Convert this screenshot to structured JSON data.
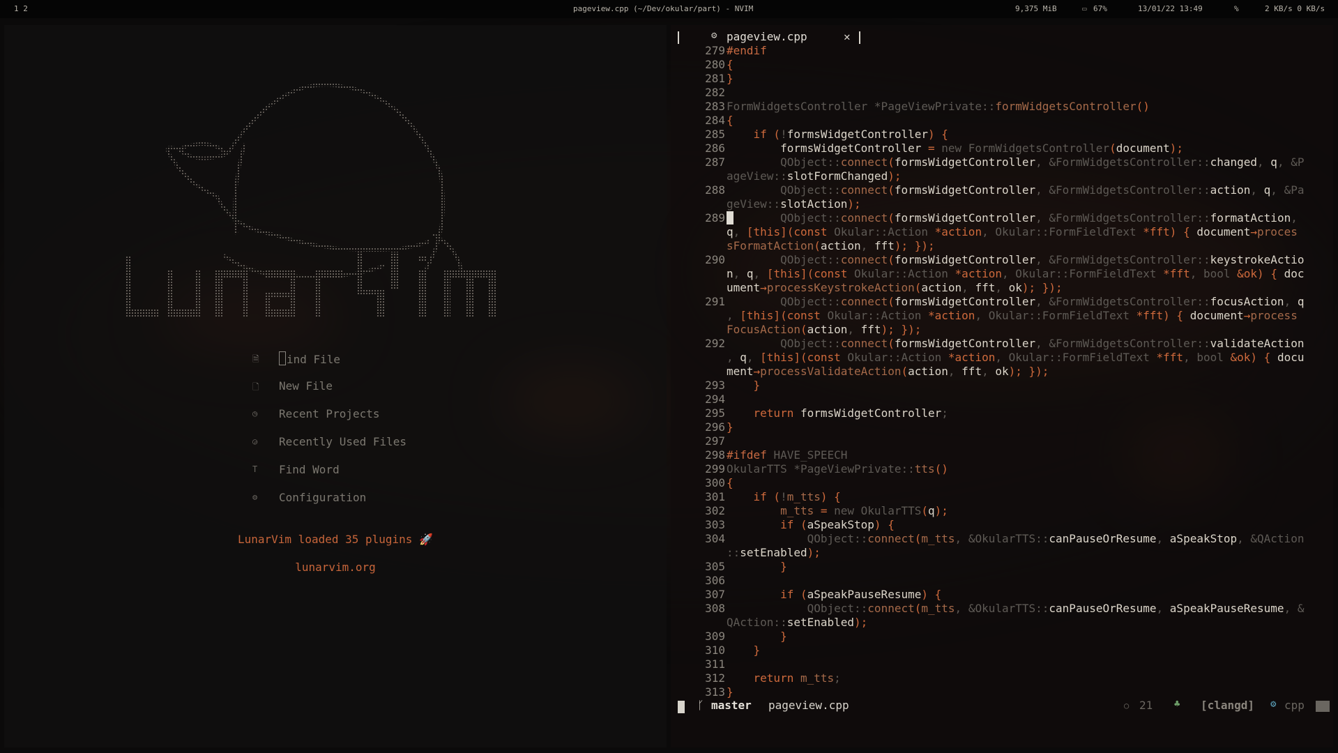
{
  "topbar": {
    "workspaces": "1 2",
    "title": "pageview.cpp (~/Dev/okular/part) - NVIM",
    "memory": "9,375 MiB",
    "battery": "67%",
    "datetime": "13/01/22 13:49",
    "net_icon": "%",
    "net_speed": "2 KB/s 0 KB/s"
  },
  "dashboard": {
    "logo_alt": "LunarVim",
    "items": [
      {
        "icon": "file-search-icon",
        "glyph": "🗎",
        "label": "Find File",
        "first_char": "F",
        "rest": "ind File"
      },
      {
        "icon": "new-file-icon",
        "glyph": "🗋",
        "label": "New File"
      },
      {
        "icon": "recent-projects-icon",
        "glyph": "◷",
        "label": "Recent Projects"
      },
      {
        "icon": "recent-files-icon",
        "glyph": "◶",
        "label": "Recently Used Files"
      },
      {
        "icon": "find-word-icon",
        "glyph": "T",
        "label": "Find Word"
      },
      {
        "icon": "config-gear-icon",
        "glyph": "⚙",
        "label": "Configuration"
      }
    ],
    "footer_loaded": "LunarVim loaded 35 plugins 🚀",
    "footer_site": "lunarvim.org"
  },
  "editor": {
    "tab": {
      "icon": "settings-file-icon",
      "name": "pageview.cpp",
      "close": "✕"
    },
    "statusline": {
      "branch_icon": "git-branch-icon",
      "branch": "master",
      "file": "pageview.cpp",
      "diag_icon": "warning-circle-icon",
      "diag_count": "21",
      "tree_icon": "tree-icon",
      "lsp": "[clangd]",
      "ft_icon": "cpp-icon",
      "filetype": "cpp"
    },
    "cursor_line": 289,
    "lines": [
      {
        "n": "279",
        "segs": [
          [
            "pp",
            "#endif"
          ]
        ]
      },
      {
        "n": "280",
        "segs": [
          [
            "k",
            "{"
          ]
        ]
      },
      {
        "n": "281",
        "segs": [
          [
            "k",
            "}"
          ]
        ]
      },
      {
        "n": "282",
        "segs": []
      },
      {
        "n": "283",
        "segs": [
          [
            "dim",
            "FormWidgetsController *PageViewPrivate"
          ],
          [
            "dim",
            "::"
          ],
          [
            "f",
            "formWidgetsController"
          ],
          [
            "k",
            "()"
          ]
        ]
      },
      {
        "n": "284",
        "segs": [
          [
            "k",
            "{"
          ]
        ]
      },
      {
        "n": "285",
        "segs": [
          [
            "",
            "    "
          ],
          [
            "k",
            "if ("
          ],
          [
            "dim",
            "!"
          ],
          [
            "id",
            "formsWidgetController"
          ],
          [
            "k",
            ") {"
          ]
        ]
      },
      {
        "n": "286",
        "segs": [
          [
            "",
            "        "
          ],
          [
            "id",
            "formsWidgetController "
          ],
          [
            "k",
            "= "
          ],
          [
            "dim",
            "new "
          ],
          [
            "dim",
            "FormWidgetsController"
          ],
          [
            "k",
            "("
          ],
          [
            "id",
            "document"
          ],
          [
            "k",
            ");"
          ]
        ]
      },
      {
        "n": "287",
        "segs": [
          [
            "",
            "        "
          ],
          [
            "dim",
            "QObject::"
          ],
          [
            "f",
            "connect"
          ],
          [
            "k",
            "("
          ],
          [
            "id",
            "formsWidgetController"
          ],
          [
            "dim",
            ", &FormWidgetsController::"
          ],
          [
            "id",
            "changed"
          ],
          [
            "dim",
            ", "
          ],
          [
            "id",
            "q"
          ],
          [
            "dim",
            ", &P"
          ]
        ]
      },
      {
        "n": "",
        "segs": [
          [
            "dim",
            "ageView::"
          ],
          [
            "id",
            "slotFormChanged"
          ],
          [
            "k",
            ");"
          ]
        ]
      },
      {
        "n": "288",
        "segs": [
          [
            "",
            "        "
          ],
          [
            "dim",
            "QObject::"
          ],
          [
            "f",
            "connect"
          ],
          [
            "k",
            "("
          ],
          [
            "id",
            "formsWidgetController"
          ],
          [
            "dim",
            ", &FormWidgetsController::"
          ],
          [
            "id",
            "action"
          ],
          [
            "dim",
            ", "
          ],
          [
            "id",
            "q"
          ],
          [
            "dim",
            ", &Pa"
          ]
        ]
      },
      {
        "n": "",
        "segs": [
          [
            "dim",
            "geView::"
          ],
          [
            "id",
            "slotAction"
          ],
          [
            "k",
            ");"
          ]
        ]
      },
      {
        "n": "289",
        "segs": [
          [
            "cur",
            " "
          ],
          [
            "",
            "       "
          ],
          [
            "dim",
            "QObject::"
          ],
          [
            "f",
            "connect"
          ],
          [
            "k",
            "("
          ],
          [
            "id",
            "formsWidgetController"
          ],
          [
            "dim",
            ", &FormWidgetsController::"
          ],
          [
            "id",
            "formatAction"
          ],
          [
            "dim",
            ","
          ]
        ]
      },
      {
        "n": "",
        "segs": [
          [
            "id",
            "q"
          ],
          [
            "dim",
            ", "
          ],
          [
            "k",
            "[this]("
          ],
          [
            "k",
            "const "
          ],
          [
            "dim",
            "Okular::Action "
          ],
          [
            "k",
            "*action"
          ],
          [
            "dim",
            ", Okular::FormFieldText "
          ],
          [
            "k",
            "*fft"
          ],
          [
            "k",
            ") { "
          ],
          [
            "id",
            "document"
          ],
          [
            "k",
            "→"
          ],
          [
            "f",
            "proces"
          ]
        ]
      },
      {
        "n": "",
        "segs": [
          [
            "f",
            "sFormatAction"
          ],
          [
            "k",
            "("
          ],
          [
            "id",
            "action"
          ],
          [
            "dim",
            ", "
          ],
          [
            "id",
            "fft"
          ],
          [
            "k",
            "); });"
          ]
        ]
      },
      {
        "n": "290",
        "segs": [
          [
            "",
            "        "
          ],
          [
            "dim",
            "QObject::"
          ],
          [
            "f",
            "connect"
          ],
          [
            "k",
            "("
          ],
          [
            "id",
            "formsWidgetController"
          ],
          [
            "dim",
            ", &FormWidgetsController::"
          ],
          [
            "id",
            "keystrokeActio"
          ]
        ]
      },
      {
        "n": "",
        "segs": [
          [
            "id",
            "n"
          ],
          [
            "dim",
            ", "
          ],
          [
            "id",
            "q"
          ],
          [
            "dim",
            ", "
          ],
          [
            "k",
            "[this]("
          ],
          [
            "k",
            "const "
          ],
          [
            "dim",
            "Okular::Action "
          ],
          [
            "k",
            "*action"
          ],
          [
            "dim",
            ", Okular::FormFieldText "
          ],
          [
            "k",
            "*fft"
          ],
          [
            "dim",
            ", bool "
          ],
          [
            "k",
            "&ok"
          ],
          [
            "k",
            ") { "
          ],
          [
            "id",
            "doc"
          ]
        ]
      },
      {
        "n": "",
        "segs": [
          [
            "id",
            "ument"
          ],
          [
            "k",
            "→"
          ],
          [
            "f",
            "processKeystrokeAction"
          ],
          [
            "k",
            "("
          ],
          [
            "id",
            "action"
          ],
          [
            "dim",
            ", "
          ],
          [
            "id",
            "fft"
          ],
          [
            "dim",
            ", "
          ],
          [
            "id",
            "ok"
          ],
          [
            "k",
            "); });"
          ]
        ]
      },
      {
        "n": "291",
        "segs": [
          [
            "",
            "        "
          ],
          [
            "dim",
            "QObject::"
          ],
          [
            "f",
            "connect"
          ],
          [
            "k",
            "("
          ],
          [
            "id",
            "formsWidgetController"
          ],
          [
            "dim",
            ", &FormWidgetsController::"
          ],
          [
            "id",
            "focusAction"
          ],
          [
            "dim",
            ", "
          ],
          [
            "id",
            "q"
          ]
        ]
      },
      {
        "n": "",
        "segs": [
          [
            "dim",
            ", "
          ],
          [
            "k",
            "[this]("
          ],
          [
            "k",
            "const "
          ],
          [
            "dim",
            "Okular::Action "
          ],
          [
            "k",
            "*action"
          ],
          [
            "dim",
            ", Okular::FormFieldText "
          ],
          [
            "k",
            "*fft"
          ],
          [
            "k",
            ") { "
          ],
          [
            "id",
            "document"
          ],
          [
            "k",
            "→"
          ],
          [
            "f",
            "process"
          ]
        ]
      },
      {
        "n": "",
        "segs": [
          [
            "f",
            "FocusAction"
          ],
          [
            "k",
            "("
          ],
          [
            "id",
            "action"
          ],
          [
            "dim",
            ", "
          ],
          [
            "id",
            "fft"
          ],
          [
            "k",
            "); });"
          ]
        ]
      },
      {
        "n": "292",
        "segs": [
          [
            "",
            "        "
          ],
          [
            "dim",
            "QObject::"
          ],
          [
            "f",
            "connect"
          ],
          [
            "k",
            "("
          ],
          [
            "id",
            "formsWidgetController"
          ],
          [
            "dim",
            ", &FormWidgetsController::"
          ],
          [
            "id",
            "validateAction"
          ]
        ]
      },
      {
        "n": "",
        "segs": [
          [
            "dim",
            ", "
          ],
          [
            "id",
            "q"
          ],
          [
            "dim",
            ", "
          ],
          [
            "k",
            "[this]("
          ],
          [
            "k",
            "const "
          ],
          [
            "dim",
            "Okular::Action "
          ],
          [
            "k",
            "*action"
          ],
          [
            "dim",
            ", Okular::FormFieldText "
          ],
          [
            "k",
            "*fft"
          ],
          [
            "dim",
            ", bool "
          ],
          [
            "k",
            "&ok"
          ],
          [
            "k",
            ") { "
          ],
          [
            "id",
            "docu"
          ]
        ]
      },
      {
        "n": "",
        "segs": [
          [
            "id",
            "ment"
          ],
          [
            "k",
            "→"
          ],
          [
            "f",
            "processValidateAction"
          ],
          [
            "k",
            "("
          ],
          [
            "id",
            "action"
          ],
          [
            "dim",
            ", "
          ],
          [
            "id",
            "fft"
          ],
          [
            "dim",
            ", "
          ],
          [
            "id",
            "ok"
          ],
          [
            "k",
            "); });"
          ]
        ]
      },
      {
        "n": "293",
        "segs": [
          [
            "",
            "    "
          ],
          [
            "k",
            "}"
          ]
        ]
      },
      {
        "n": "294",
        "segs": []
      },
      {
        "n": "295",
        "segs": [
          [
            "",
            "    "
          ],
          [
            "k",
            "return "
          ],
          [
            "id",
            "formsWidgetController"
          ],
          [
            "dim",
            ";"
          ]
        ]
      },
      {
        "n": "296",
        "segs": [
          [
            "k",
            "}"
          ]
        ]
      },
      {
        "n": "297",
        "segs": []
      },
      {
        "n": "298",
        "segs": [
          [
            "pp",
            "#ifdef "
          ],
          [
            "dim",
            "HAVE_SPEECH"
          ]
        ]
      },
      {
        "n": "299",
        "segs": [
          [
            "dim",
            "OkularTTS *PageViewPrivate::"
          ],
          [
            "f",
            "tts"
          ],
          [
            "k",
            "()"
          ]
        ]
      },
      {
        "n": "300",
        "segs": [
          [
            "k",
            "{"
          ]
        ]
      },
      {
        "n": "301",
        "segs": [
          [
            "",
            "    "
          ],
          [
            "k",
            "if ("
          ],
          [
            "dim",
            "!"
          ],
          [
            "f",
            "m_tts"
          ],
          [
            "k",
            ") {"
          ]
        ]
      },
      {
        "n": "302",
        "segs": [
          [
            "",
            "        "
          ],
          [
            "f",
            "m_tts "
          ],
          [
            "k",
            "= "
          ],
          [
            "dim",
            "new OkularTTS"
          ],
          [
            "k",
            "("
          ],
          [
            "id",
            "q"
          ],
          [
            "k",
            ");"
          ]
        ]
      },
      {
        "n": "303",
        "segs": [
          [
            "",
            "        "
          ],
          [
            "k",
            "if ("
          ],
          [
            "id",
            "aSpeakStop"
          ],
          [
            "k",
            ") {"
          ]
        ]
      },
      {
        "n": "304",
        "segs": [
          [
            "",
            "            "
          ],
          [
            "dim",
            "QObject::"
          ],
          [
            "f",
            "connect"
          ],
          [
            "k",
            "("
          ],
          [
            "f",
            "m_tts"
          ],
          [
            "dim",
            ", &OkularTTS::"
          ],
          [
            "id",
            "canPauseOrResume"
          ],
          [
            "dim",
            ", "
          ],
          [
            "id",
            "aSpeakStop"
          ],
          [
            "dim",
            ", &QAction"
          ]
        ]
      },
      {
        "n": "",
        "segs": [
          [
            "dim",
            "::"
          ],
          [
            "id",
            "setEnabled"
          ],
          [
            "k",
            ");"
          ]
        ]
      },
      {
        "n": "305",
        "segs": [
          [
            "",
            "        "
          ],
          [
            "k",
            "}"
          ]
        ]
      },
      {
        "n": "306",
        "segs": []
      },
      {
        "n": "307",
        "segs": [
          [
            "",
            "        "
          ],
          [
            "k",
            "if ("
          ],
          [
            "id",
            "aSpeakPauseResume"
          ],
          [
            "k",
            ") {"
          ]
        ]
      },
      {
        "n": "308",
        "segs": [
          [
            "",
            "            "
          ],
          [
            "dim",
            "QObject::"
          ],
          [
            "f",
            "connect"
          ],
          [
            "k",
            "("
          ],
          [
            "f",
            "m_tts"
          ],
          [
            "dim",
            ", &OkularTTS::"
          ],
          [
            "id",
            "canPauseOrResume"
          ],
          [
            "dim",
            ", "
          ],
          [
            "id",
            "aSpeakPauseResume"
          ],
          [
            "dim",
            ", &"
          ]
        ]
      },
      {
        "n": "",
        "segs": [
          [
            "dim",
            "QAction::"
          ],
          [
            "id",
            "setEnabled"
          ],
          [
            "k",
            ");"
          ]
        ]
      },
      {
        "n": "309",
        "segs": [
          [
            "",
            "        "
          ],
          [
            "k",
            "}"
          ]
        ]
      },
      {
        "n": "310",
        "segs": [
          [
            "",
            "    "
          ],
          [
            "k",
            "}"
          ]
        ]
      },
      {
        "n": "311",
        "segs": []
      },
      {
        "n": "312",
        "segs": [
          [
            "",
            "    "
          ],
          [
            "k",
            "return "
          ],
          [
            "f",
            "m_tts"
          ],
          [
            "dim",
            ";"
          ]
        ]
      },
      {
        "n": "313",
        "segs": [
          [
            "k",
            "}"
          ]
        ]
      }
    ]
  },
  "colors": {
    "accent": "#cf6a3c",
    "func": "#a66a4a",
    "dim": "#5e5a55",
    "text": "#d8d2c6",
    "lineno": "#8a857d"
  }
}
